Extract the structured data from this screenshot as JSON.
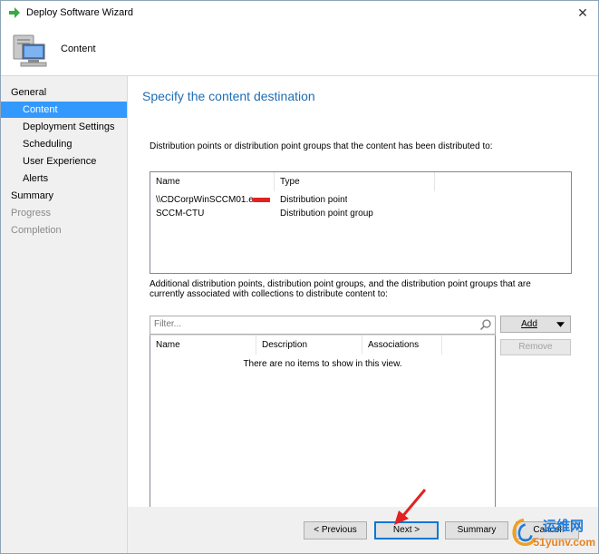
{
  "window": {
    "title": "Deploy Software Wizard",
    "close_glyph": "✕"
  },
  "header": {
    "title": "Content"
  },
  "sidebar": {
    "items": [
      {
        "label": "General"
      },
      {
        "label": "Content"
      },
      {
        "label": "Deployment Settings"
      },
      {
        "label": "Scheduling"
      },
      {
        "label": "User Experience"
      },
      {
        "label": "Alerts"
      },
      {
        "label": "Summary"
      },
      {
        "label": "Progress"
      },
      {
        "label": "Completion"
      }
    ]
  },
  "main": {
    "heading": "Specify the content destination",
    "distributed_desc": "Distribution points or distribution point groups that the content has been distributed to:",
    "distributed_list": {
      "columns": [
        "Name",
        "Type"
      ],
      "rows": [
        {
          "name": "\\\\CDCorpWinSCCM01.e",
          "type": "Distribution point"
        },
        {
          "name": "SCCM-CTU",
          "type": "Distribution point group"
        }
      ]
    },
    "additional_desc": "Additional distribution points, distribution point groups, and the distribution point groups that are currently associated with collections to distribute content to:",
    "filter_placeholder": "Filter...",
    "add_label": "Add",
    "remove_label": "Remove",
    "additional_list": {
      "columns": [
        "Name",
        "Description",
        "Associations"
      ],
      "empty_message": "There are no items to show in this view."
    }
  },
  "footer": {
    "previous_label": "< Previous",
    "next_label": "Next >",
    "summary_label": "Summary",
    "cancel_label": "Cancel"
  },
  "watermark": {
    "line1": "运维网",
    "line2": "51yunv.com"
  },
  "colors": {
    "accent": "#3399ff",
    "heading": "#1e6db5",
    "annotation": "#e32121"
  }
}
